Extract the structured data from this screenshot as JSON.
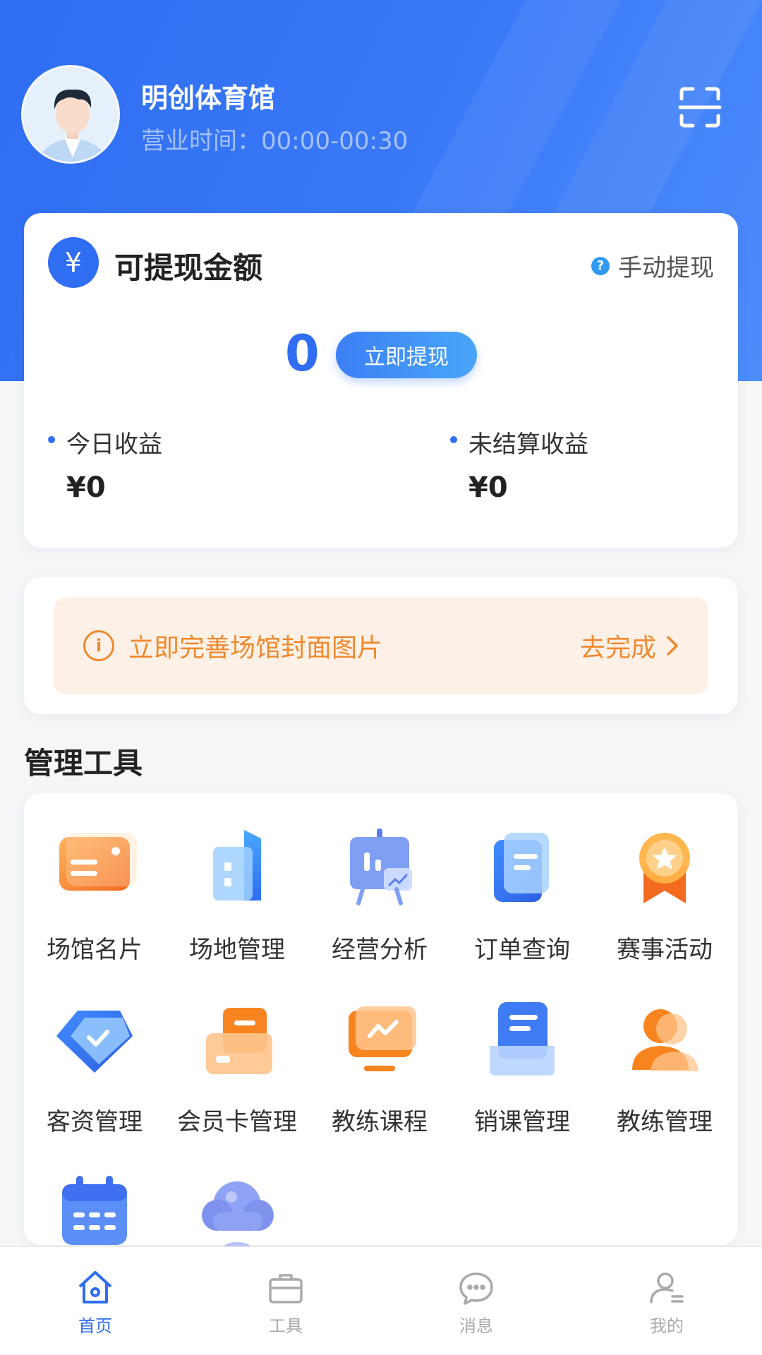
{
  "header": {
    "venue_name": "明创体育馆",
    "hours": "营业时间：00:00-00:30"
  },
  "wallet": {
    "currency_symbol": "¥",
    "title": "可提现金额",
    "manual_label": "手动提现",
    "amount": "0",
    "withdraw_label": "立即提现",
    "today_label": "今日收益",
    "today_value": "¥0",
    "unsettled_label": "未结算收益",
    "unsettled_value": "¥0"
  },
  "notice": {
    "message": "立即完善场馆封面图片",
    "action": "去完成"
  },
  "tools": {
    "title": "管理工具",
    "items": [
      {
        "label": "场馆名片",
        "icon": "venue-card-icon"
      },
      {
        "label": "场地管理",
        "icon": "building-icon"
      },
      {
        "label": "经营分析",
        "icon": "presentation-chart-icon"
      },
      {
        "label": "订单查询",
        "icon": "document-icon"
      },
      {
        "label": "赛事活动",
        "icon": "medal-icon"
      },
      {
        "label": "客资管理",
        "icon": "diamond-check-icon"
      },
      {
        "label": "会员卡管理",
        "icon": "member-card-icon"
      },
      {
        "label": "教练课程",
        "icon": "monitor-chart-icon"
      },
      {
        "label": "销课管理",
        "icon": "tray-document-icon"
      },
      {
        "label": "教练管理",
        "icon": "user-icon"
      },
      {
        "label": "",
        "icon": "calendar-icon"
      },
      {
        "label": "",
        "icon": "cloud-icon"
      }
    ]
  },
  "tabbar": {
    "items": [
      {
        "label": "首页",
        "icon": "home-icon",
        "active": true
      },
      {
        "label": "工具",
        "icon": "briefcase-icon",
        "active": false
      },
      {
        "label": "消息",
        "icon": "chat-icon",
        "active": false
      },
      {
        "label": "我的",
        "icon": "profile-icon",
        "active": false
      }
    ]
  },
  "colors": {
    "primary": "#2f6df2",
    "accent_orange": "#f0892e",
    "notice_bg": "#fdf1e7"
  }
}
